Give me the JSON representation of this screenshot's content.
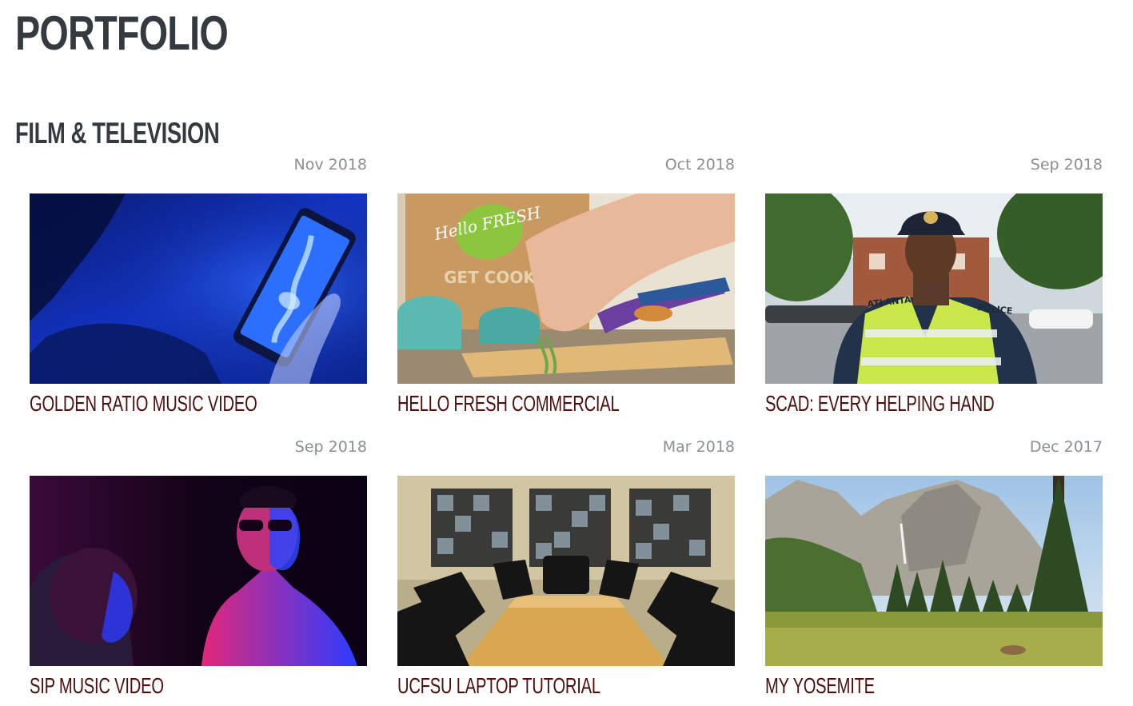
{
  "page": {
    "title": "PORTFOLIO"
  },
  "section": {
    "title": "FILM & TELEVISION"
  },
  "projects": [
    {
      "date": "Nov 2018",
      "title": "GOLDEN RATIO MUSIC VIDEO",
      "thumbnail": "phone-xray-thumbnail"
    },
    {
      "date": "Oct 2018",
      "title": "HELLO FRESH COMMERCIAL",
      "thumbnail": "cooking-thumbnail"
    },
    {
      "date": "Sep 2018",
      "title": "SCAD: EVERY HELPING HAND",
      "thumbnail": "police-officer-thumbnail"
    },
    {
      "date": "Sep 2018",
      "title": "SIP MUSIC VIDEO",
      "thumbnail": "neon-portrait-thumbnail"
    },
    {
      "date": "Mar 2018",
      "title": "UCFSU LAPTOP TUTORIAL",
      "thumbnail": "conference-room-thumbnail"
    },
    {
      "date": "Dec 2017",
      "title": "MY YOSEMITE",
      "thumbnail": "yosemite-landscape-thumbnail"
    }
  ],
  "thumbnail_lettering": {
    "hello_fresh_logo": "Hello FRESH",
    "box_text": "GET COOKING",
    "vest_left": "ATLANTA",
    "vest_right": "POLICE"
  },
  "colors": {
    "heading": "#343a40",
    "card_title": "#4a0f0f",
    "date": "#8a8f96"
  }
}
